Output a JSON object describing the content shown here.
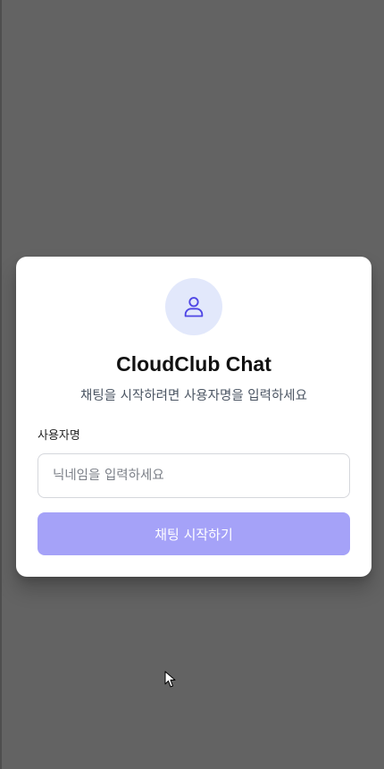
{
  "login": {
    "title": "CloudClub Chat",
    "subtitle": "채팅을 시작하려면 사용자명을 입력하세요",
    "username_label": "사용자명",
    "username_value": "",
    "username_placeholder": "닉네임을 입력하세요",
    "submit_label": "채팅 시작하기"
  },
  "icons": {
    "avatar": "user-icon",
    "pointer": "mouse-cursor-icon"
  },
  "colors": {
    "backdrop": "#636363",
    "card": "#ffffff",
    "avatar_bg": "#e2e8fb",
    "avatar_icon": "#4f46e5",
    "button_bg": "#a5a2f8",
    "button_text": "#ffffff"
  }
}
